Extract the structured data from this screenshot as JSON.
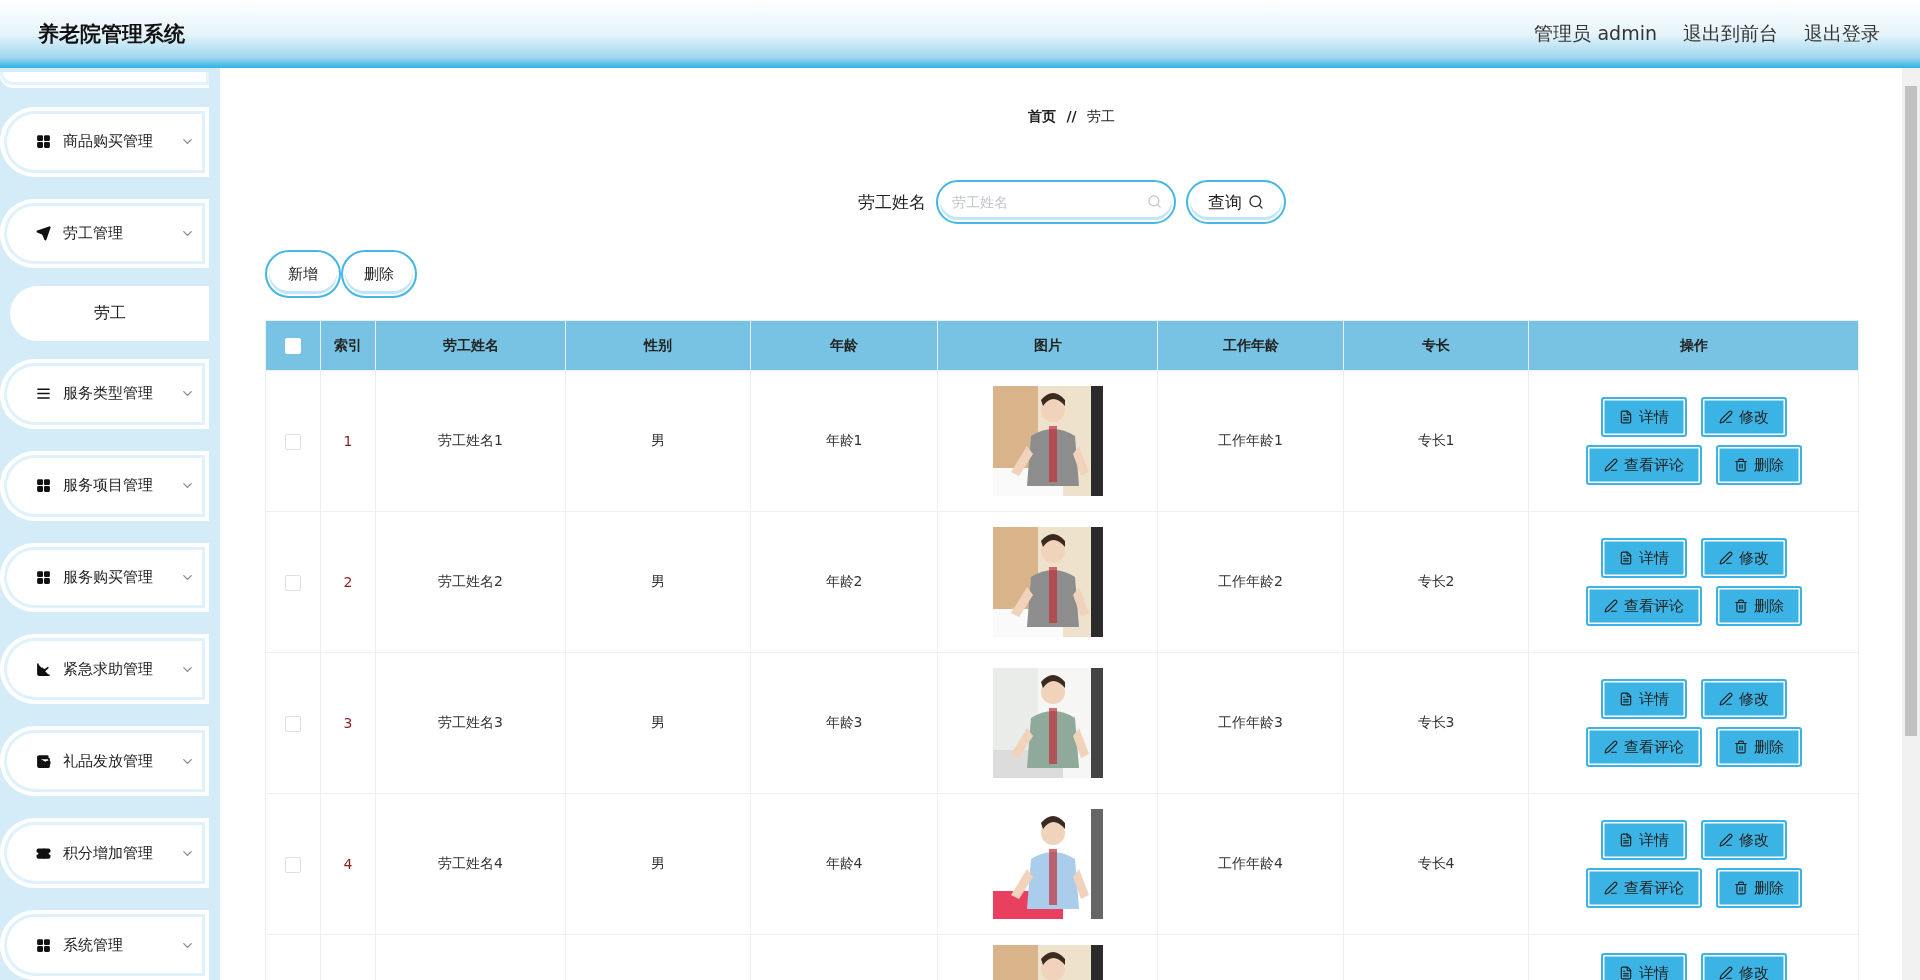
{
  "header": {
    "title": "养老院管理系统",
    "links": [
      "管理员 admin",
      "退出到前台",
      "退出登录"
    ]
  },
  "sidebar": {
    "items": [
      {
        "label": "商品购买管理",
        "kind": "grid",
        "expanded": false
      },
      {
        "label": "劳工管理",
        "kind": "send",
        "expanded": true,
        "children": [
          {
            "label": "劳工",
            "selected": true
          }
        ]
      },
      {
        "label": "服务类型管理",
        "kind": "list",
        "expanded": false
      },
      {
        "label": "服务项目管理",
        "kind": "grid",
        "expanded": false
      },
      {
        "label": "服务购买管理",
        "kind": "grid",
        "expanded": false
      },
      {
        "label": "紧急求助管理",
        "kind": "chart",
        "expanded": false
      },
      {
        "label": "礼品发放管理",
        "kind": "wallet",
        "expanded": false
      },
      {
        "label": "积分增加管理",
        "kind": "ticket",
        "expanded": false
      },
      {
        "label": "系统管理",
        "kind": "grid",
        "expanded": false
      }
    ]
  },
  "breadcrumb": [
    "首页",
    "//",
    "劳工"
  ],
  "search": {
    "label": "劳工姓名",
    "placeholder": "劳工姓名",
    "button": "查询"
  },
  "toolbar": [
    "新增",
    "删除"
  ],
  "table": {
    "columns": [
      "索引",
      "劳工姓名",
      "性别",
      "年龄",
      "图片",
      "工作年龄",
      "专长",
      "操作"
    ],
    "header_checked": false,
    "rows": [
      {
        "checked": false,
        "cells": [
          "1",
          "劳工姓名1",
          "男",
          "年龄1"
        ],
        "picture": {
          "kind": "picture"
        },
        "cells_after": [
          "工作年龄1",
          "专长1"
        ],
        "actions": [
          {
            "label": "详情",
            "kind": "detail"
          },
          {
            "label": "修改",
            "kind": "edit"
          },
          {
            "label": "查看评论",
            "kind": "edit"
          },
          {
            "label": "删除",
            "kind": "delete"
          }
        ]
      },
      {
        "checked": false,
        "cells": [
          "2",
          "劳工姓名2",
          "男",
          "年龄2"
        ],
        "picture": {
          "kind": "picture"
        },
        "cells_after": [
          "工作年龄2",
          "专长2"
        ],
        "actions": [
          {
            "label": "详情",
            "kind": "detail"
          },
          {
            "label": "修改",
            "kind": "edit"
          },
          {
            "label": "查看评论",
            "kind": "edit"
          },
          {
            "label": "删除",
            "kind": "delete"
          }
        ]
      },
      {
        "checked": false,
        "cells": [
          "3",
          "劳工姓名3",
          "男",
          "年龄3"
        ],
        "picture": {
          "kind": "picture"
        },
        "cells_after": [
          "工作年龄3",
          "专长3"
        ],
        "actions": [
          {
            "label": "详情",
            "kind": "detail"
          },
          {
            "label": "修改",
            "kind": "edit"
          },
          {
            "label": "查看评论",
            "kind": "edit"
          },
          {
            "label": "删除",
            "kind": "delete"
          }
        ]
      },
      {
        "checked": false,
        "cells": [
          "4",
          "劳工姓名4",
          "男",
          "年龄4"
        ],
        "picture": {
          "kind": "picture"
        },
        "cells_after": [
          "工作年龄4",
          "专长4"
        ],
        "actions": [
          {
            "label": "详情",
            "kind": "detail"
          },
          {
            "label": "修改",
            "kind": "edit"
          },
          {
            "label": "查看评论",
            "kind": "edit"
          },
          {
            "label": "删除",
            "kind": "delete"
          }
        ]
      },
      {
        "picture": {
          "kind": "picture"
        },
        "actions": [
          {
            "label": "详情",
            "kind": "detail"
          },
          {
            "label": "修改",
            "kind": "edit"
          }
        ]
      }
    ]
  }
}
